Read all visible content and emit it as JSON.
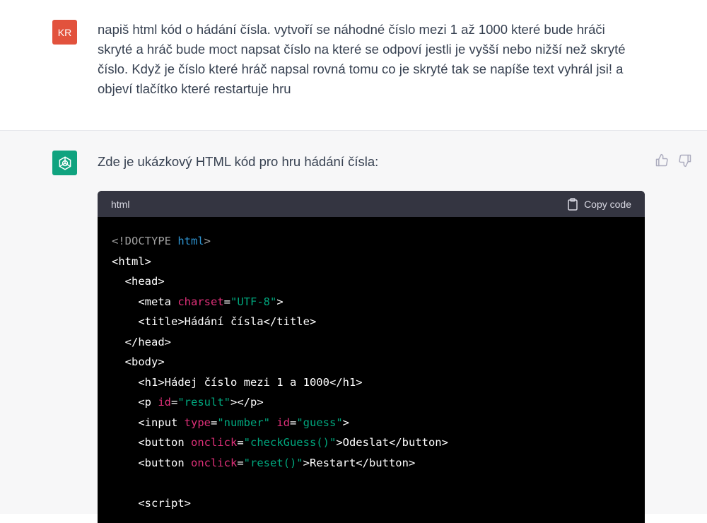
{
  "user_message": {
    "avatar_initials": "KR",
    "avatar_color": "#e2523d",
    "text": "napiš html kód o hádání čísla. vytvoří se náhodné číslo mezi 1 až 1000 které bude hráči skryté a hráč bude moct napsat číslo na které se odpoví jestli je vyšší nebo nižší než skryté číslo. Když je číslo které hráč napsal rovná tomu co je skryté tak se napíše text vyhrál jsi! a objeví tlačítko které restartuje hru"
  },
  "assistant_message": {
    "avatar_color": "#10a37f",
    "avatar_icon": "openai-logo-icon",
    "intro": "Zde je ukázkový HTML kód pro hru hádání čísla:",
    "feedback_icons": [
      "thumbs-up-icon",
      "thumbs-down-icon"
    ]
  },
  "code_block": {
    "language": "html",
    "copy_label": "Copy code",
    "copy_icon": "clipboard-icon",
    "colors": {
      "background": "#000000",
      "header": "#343541",
      "keyword": "#2e95d3",
      "attribute": "#df3079",
      "string": "#00a67d",
      "muted": "#a0a0a0"
    },
    "lines": [
      [
        {
          "t": "<!DOCTYPE ",
          "c": "muted"
        },
        {
          "t": "html",
          "c": "kw"
        },
        {
          "t": ">",
          "c": "muted"
        }
      ],
      [
        {
          "t": "<html>",
          "c": "plain"
        }
      ],
      [
        {
          "t": "  <head>",
          "c": "plain"
        }
      ],
      [
        {
          "t": "    <meta ",
          "c": "plain"
        },
        {
          "t": "charset",
          "c": "attr"
        },
        {
          "t": "=",
          "c": "plain"
        },
        {
          "t": "\"UTF-8\"",
          "c": "str"
        },
        {
          "t": ">",
          "c": "plain"
        }
      ],
      [
        {
          "t": "    <title>Hádání čísla</title>",
          "c": "plain"
        }
      ],
      [
        {
          "t": "  </head>",
          "c": "plain"
        }
      ],
      [
        {
          "t": "  <body>",
          "c": "plain"
        }
      ],
      [
        {
          "t": "    <h1>Hádej číslo mezi 1 a 1000</h1>",
          "c": "plain"
        }
      ],
      [
        {
          "t": "    <p ",
          "c": "plain"
        },
        {
          "t": "id",
          "c": "attr"
        },
        {
          "t": "=",
          "c": "plain"
        },
        {
          "t": "\"result\"",
          "c": "str"
        },
        {
          "t": "></p>",
          "c": "plain"
        }
      ],
      [
        {
          "t": "    <input ",
          "c": "plain"
        },
        {
          "t": "type",
          "c": "attr"
        },
        {
          "t": "=",
          "c": "plain"
        },
        {
          "t": "\"number\"",
          "c": "str"
        },
        {
          "t": " ",
          "c": "plain"
        },
        {
          "t": "id",
          "c": "attr"
        },
        {
          "t": "=",
          "c": "plain"
        },
        {
          "t": "\"guess\"",
          "c": "str"
        },
        {
          "t": ">",
          "c": "plain"
        }
      ],
      [
        {
          "t": "    <button ",
          "c": "plain"
        },
        {
          "t": "onclick",
          "c": "attr"
        },
        {
          "t": "=",
          "c": "plain"
        },
        {
          "t": "\"checkGuess()\"",
          "c": "str"
        },
        {
          "t": ">Odeslat</button>",
          "c": "plain"
        }
      ],
      [
        {
          "t": "    <button ",
          "c": "plain"
        },
        {
          "t": "onclick",
          "c": "attr"
        },
        {
          "t": "=",
          "c": "plain"
        },
        {
          "t": "\"reset()\"",
          "c": "str"
        },
        {
          "t": ">Restart</button>",
          "c": "plain"
        }
      ],
      [
        {
          "t": "",
          "c": "plain"
        }
      ],
      [
        {
          "t": "    <script>",
          "c": "plain"
        }
      ]
    ]
  }
}
